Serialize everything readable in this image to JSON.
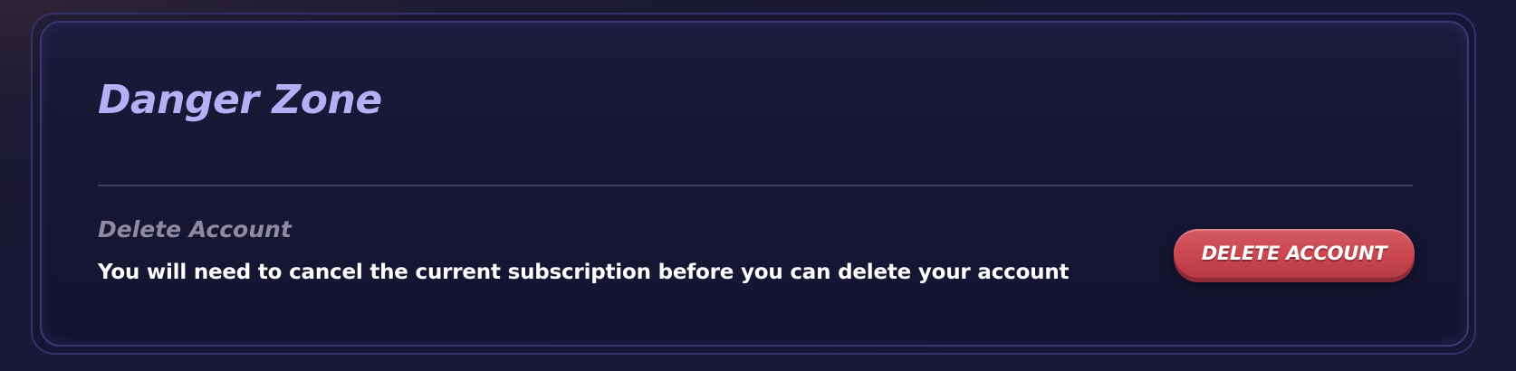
{
  "danger_zone": {
    "title": "Danger Zone",
    "section_label": "Delete Account",
    "description": "You will need to cancel the current subscription before you can delete your account",
    "delete_button_label": "DELETE ACCOUNT"
  },
  "colors": {
    "accent_title": "#b6aef6",
    "danger_button": "#c9464f",
    "background": "#191838"
  }
}
